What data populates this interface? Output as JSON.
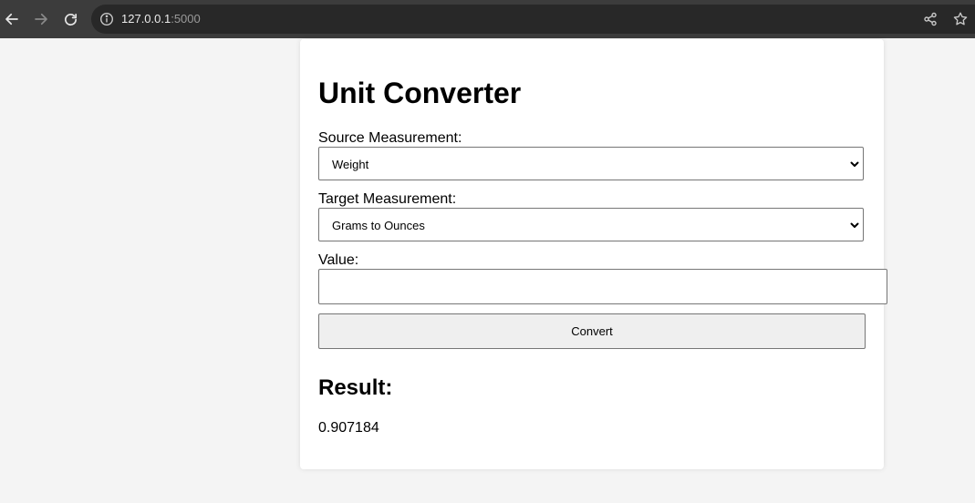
{
  "browser": {
    "url_host": "127.0.0.1",
    "url_port": ":5000"
  },
  "page": {
    "title": "Unit Converter",
    "source_label": "Source Measurement:",
    "source_selected": "Weight",
    "target_label": "Target Measurement:",
    "target_selected": "Grams to Ounces",
    "value_label": "Value:",
    "value_input": "",
    "convert_button": "Convert",
    "result_heading": "Result:",
    "result_value": "0.907184"
  }
}
